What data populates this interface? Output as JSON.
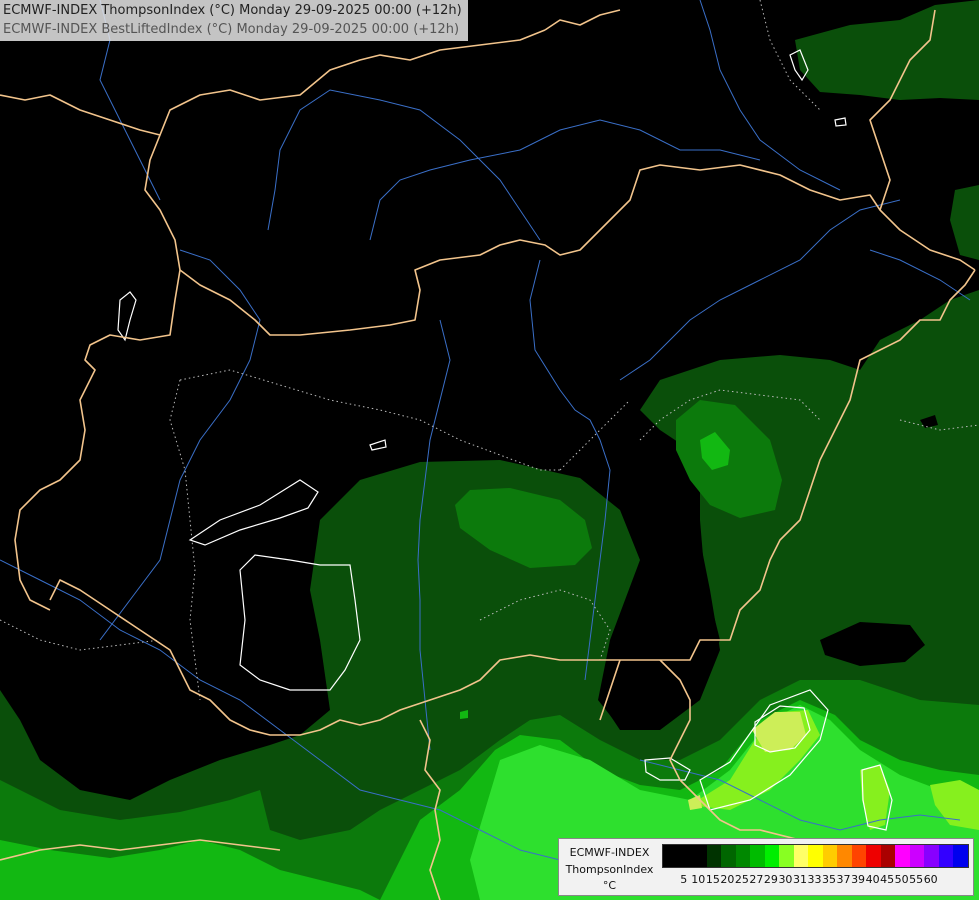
{
  "title": {
    "line1": "ECMWF-INDEX ThompsonIndex (°C) Monday 29-09-2025 00:00 (+12h)",
    "line2": "ECMWF-INDEX BestLiftedIndex (°C) Monday 29-09-2025 00:00 (+12h)"
  },
  "legend": {
    "model": "ECMWF-INDEX",
    "parameter": "ThompsonIndex",
    "unit": "°C",
    "ticks": [
      "5",
      "10",
      "15",
      "20",
      "25",
      "27",
      "29",
      "30",
      "31",
      "33",
      "35",
      "37",
      "39",
      "40",
      "45",
      "50",
      "55",
      "60"
    ],
    "colors": [
      "#000000",
      "#000000",
      "#000000",
      "#003300",
      "#006600",
      "#008800",
      "#00bb00",
      "#00ee00",
      "#88ff22",
      "#ffff66",
      "#ffff00",
      "#ffcc00",
      "#ff8800",
      "#ff4400",
      "#ee0000",
      "#aa0000",
      "#ff00ff",
      "#cc00ff",
      "#8800ff",
      "#3300ff",
      "#0000ee"
    ]
  },
  "map_colors": {
    "background": "#000000",
    "level_25": "#064d06",
    "level_27": "#0a8a0a",
    "level_29": "#10c010",
    "level_30": "#2fe82f",
    "level_31": "#7cf51a",
    "level_33": "#c9f055",
    "borders": "#f2c48c",
    "rivers": "#3a6fc8",
    "contours_dotted": "#aaaaaa",
    "contours_white": "#ffffff"
  }
}
